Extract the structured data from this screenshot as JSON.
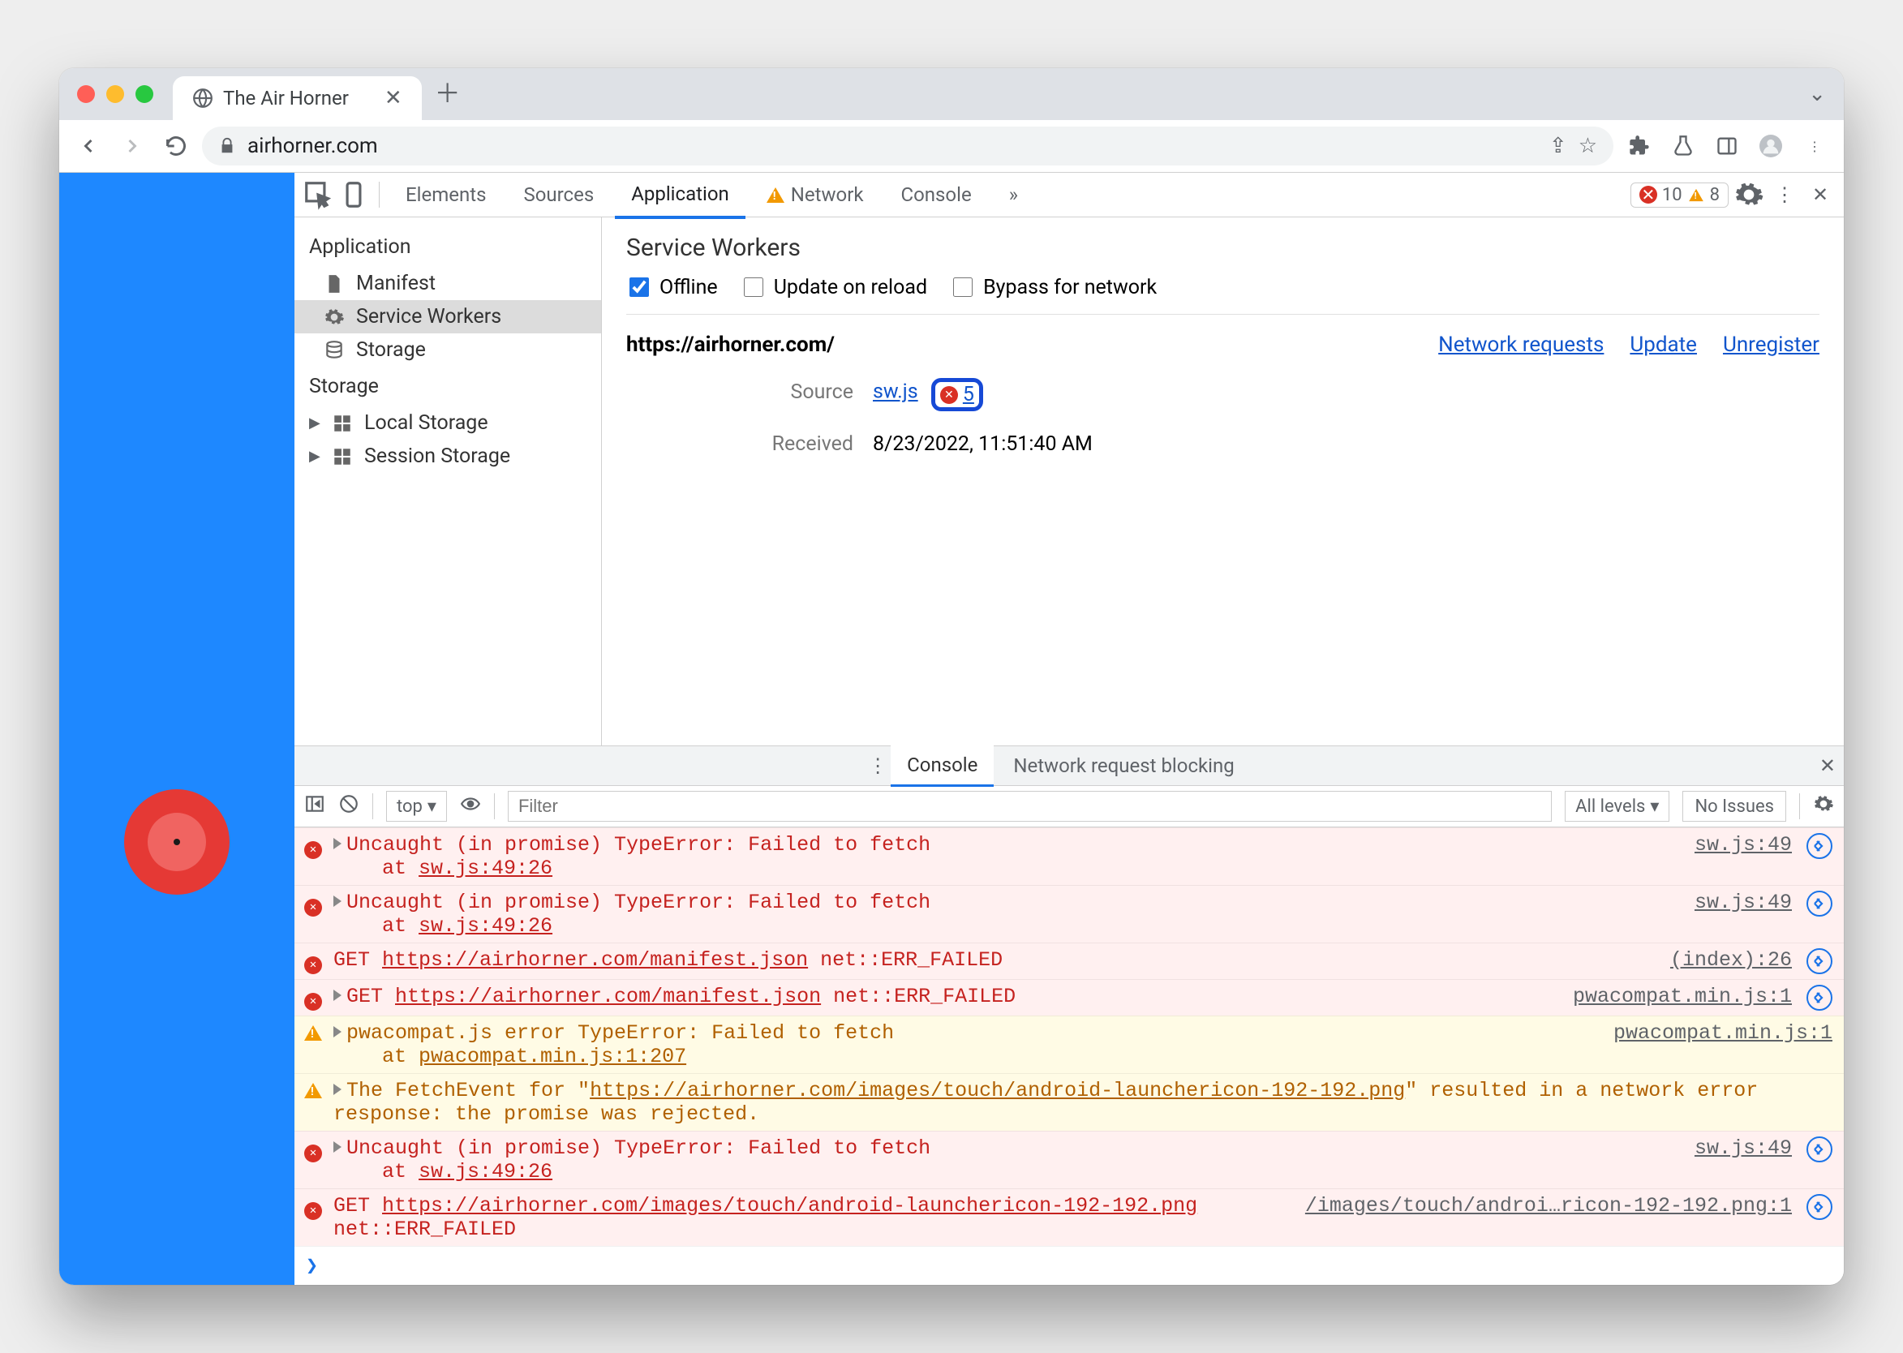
{
  "browser": {
    "tab_title": "The Air Horner",
    "address": "airhorner.com"
  },
  "devtools": {
    "tabs": {
      "elements": "Elements",
      "sources": "Sources",
      "application": "Application",
      "network": "Network",
      "console": "Console"
    },
    "badge_errors": "10",
    "badge_warnings": "8"
  },
  "sidebar": {
    "section_application": "Application",
    "items_app": [
      "Manifest",
      "Service Workers",
      "Storage"
    ],
    "section_storage": "Storage",
    "items_storage": [
      "Local Storage",
      "Session Storage"
    ]
  },
  "sw": {
    "heading": "Service Workers",
    "offline_label": "Offline",
    "update_label": "Update on reload",
    "bypass_label": "Bypass for network",
    "scope": "https://airhorner.com/",
    "link_network": "Network requests",
    "link_update": "Update",
    "link_unregister": "Unregister",
    "source_label": "Source",
    "source_file": "sw.js",
    "error_count": "5",
    "received_label": "Received",
    "received_value": "8/23/2022, 11:51:40 AM"
  },
  "drawer": {
    "tab_console": "Console",
    "tab_nrb": "Network request blocking",
    "context": "top",
    "filter_placeholder": "Filter",
    "levels": "All levels",
    "issues": "No Issues"
  },
  "console_rows": [
    {
      "type": "err",
      "expand": true,
      "text": "Uncaught (in promise) TypeError: Failed to fetch\n    at ",
      "link": "sw.js:49:26",
      "src": "sw.js:49",
      "nav": true
    },
    {
      "type": "err",
      "expand": true,
      "text": "Uncaught (in promise) TypeError: Failed to fetch\n    at ",
      "link": "sw.js:49:26",
      "src": "sw.js:49",
      "nav": true
    },
    {
      "type": "err",
      "expand": false,
      "prefix": "GET ",
      "url": "https://airhorner.com/manifest.json",
      "suffix": " net::ERR_FAILED",
      "src": "(index):26",
      "nav": true
    },
    {
      "type": "err",
      "expand": true,
      "prefix": "GET ",
      "url": "https://airhorner.com/manifest.json",
      "suffix": " net::ERR_FAILED",
      "src": "pwacompat.min.js:1",
      "nav": true
    },
    {
      "type": "warn",
      "expand": true,
      "text": "pwacompat.js error TypeError: Failed to fetch\n    at ",
      "link": "pwacompat.min.js:1:207",
      "src": "pwacompat.min.js:1"
    },
    {
      "type": "warn",
      "expand": true,
      "text": "The FetchEvent for \"",
      "url": "https://airhorner.com/images/touch/android-launchericon-192-192.png",
      "suffix": "\" resulted in a network error response: the promise was rejected."
    },
    {
      "type": "err",
      "expand": true,
      "text": "Uncaught (in promise) TypeError: Failed to fetch\n    at ",
      "link": "sw.js:49:26",
      "src": "sw.js:49",
      "nav": true
    },
    {
      "type": "err",
      "expand": false,
      "prefix": "GET ",
      "url": "https://airhorner.com/images/touch/android-launchericon-192-192.png",
      "suffix": " net::ERR_FAILED",
      "src": "/images/touch/androi…ricon-192-192.png:1",
      "nav": true
    }
  ]
}
